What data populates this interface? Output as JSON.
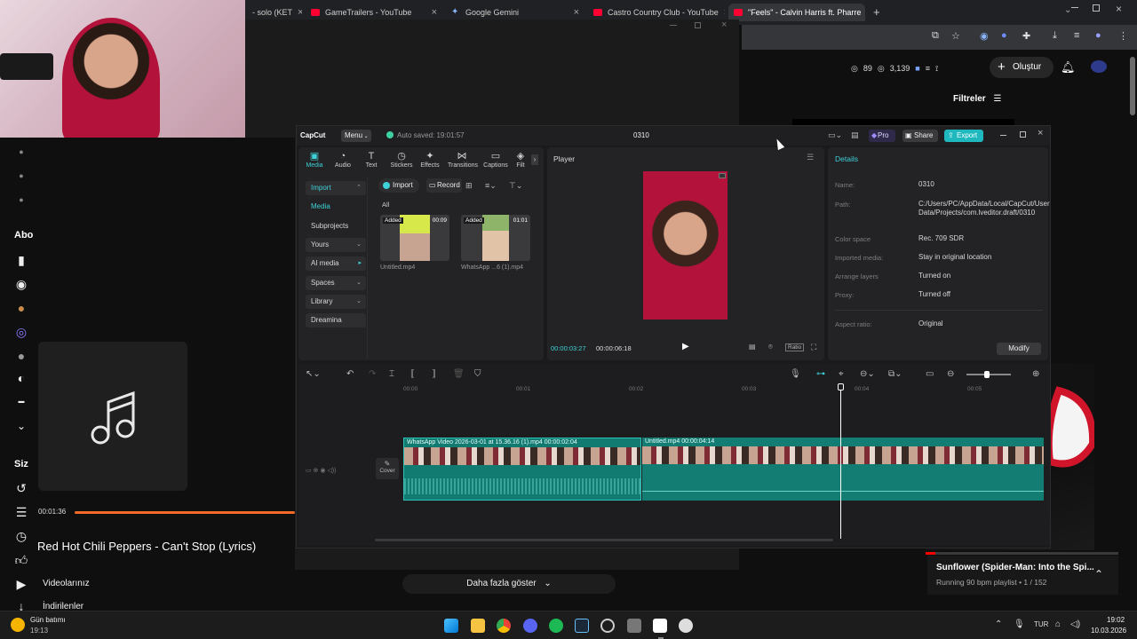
{
  "browser": {
    "tabs": [
      {
        "title": "- solo (KET",
        "active": false
      },
      {
        "title": "GameTrailers - YouTube",
        "active": false
      },
      {
        "title": "Google Gemini",
        "active": false
      },
      {
        "title": "Castro Country Club - YouTube",
        "active": false
      },
      {
        "title": "\"Feels\" - Calvin Harris ft. Pharre",
        "active": true
      }
    ],
    "new_tab": "+"
  },
  "youtube": {
    "stats": {
      "views": "89",
      "likes": "3,139"
    },
    "create_label": "Oluştur",
    "filters_label": "Filtreler",
    "side_partial": {
      "abo": "Abo",
      "siz": "Siz"
    },
    "side_items": [
      "Videolarınız",
      "İndirilenler"
    ],
    "show_more": "Daha fazla göster",
    "playlist": {
      "title": "Sunflower (Spider-Man: Into the Spi...",
      "subtitle": "Running 90 bpm playlist • 1 / 152"
    }
  },
  "music": {
    "time": "00:01:36",
    "progress": 1.0,
    "title": "Red Hot Chili Peppers - Can't Stop (Lyrics)"
  },
  "capcut": {
    "app_name": "CapCut",
    "menu_label": "Menu",
    "autosave": "Auto saved: 19:01:57",
    "project_title": "0310",
    "pro_label": "Pro",
    "share_label": "Share",
    "export_label": "Export",
    "categories": [
      "Media",
      "Audio",
      "Text",
      "Stickers",
      "Effects",
      "Transitions",
      "Captions",
      "Filt"
    ],
    "nav": [
      "Import",
      "Media",
      "Subprojects",
      "Yours",
      "AI media",
      "Spaces",
      "Library",
      "Dreamina"
    ],
    "import_btn": "Import",
    "record_btn": "Record",
    "filter_all": "All",
    "media_items": [
      {
        "name": "Untitled.mp4",
        "badge": "Added",
        "duration": "00:09"
      },
      {
        "name": "WhatsApp ...6 (1).mp4",
        "badge": "Added",
        "duration": "01:01"
      }
    ],
    "player": {
      "title": "Player",
      "current": "00:00:03:27",
      "total": "00:00:06:18",
      "ratio_label": "Ratio"
    },
    "details": {
      "title": "Details",
      "rows": [
        {
          "label": "Name:",
          "value": "0310"
        },
        {
          "label": "Path:",
          "value": "C:/Users/PC/AppData/Local/CapCut/User Data/Projects/com.lveditor.draft/0310"
        },
        {
          "label": "Color space",
          "value": "Rec. 709 SDR"
        },
        {
          "label": "Imported media:",
          "value": "Stay in original location"
        },
        {
          "label": "Arrange layers",
          "value": "Turned on"
        },
        {
          "label": "Proxy:",
          "value": "Turned off"
        },
        {
          "label": "Aspect ratio:",
          "value": "Original"
        }
      ],
      "modify_label": "Modify"
    },
    "timeline": {
      "ruler": [
        "00:00",
        "00:01",
        "00:02",
        "00:03",
        "00:04",
        "00:05"
      ],
      "cover_label": "Cover",
      "clips": [
        {
          "label": "WhatsApp Video 2026-03-01 at 15.36.16 (1).mp4  00:00:02:04"
        },
        {
          "label": "Untitled.mp4  00:00:04:14"
        }
      ]
    }
  },
  "taskbar": {
    "weather_title": "Gün batımı",
    "weather_time": "19:13",
    "lang": "TUR",
    "clock_time": "19:02",
    "clock_date": "10.03.2026"
  }
}
